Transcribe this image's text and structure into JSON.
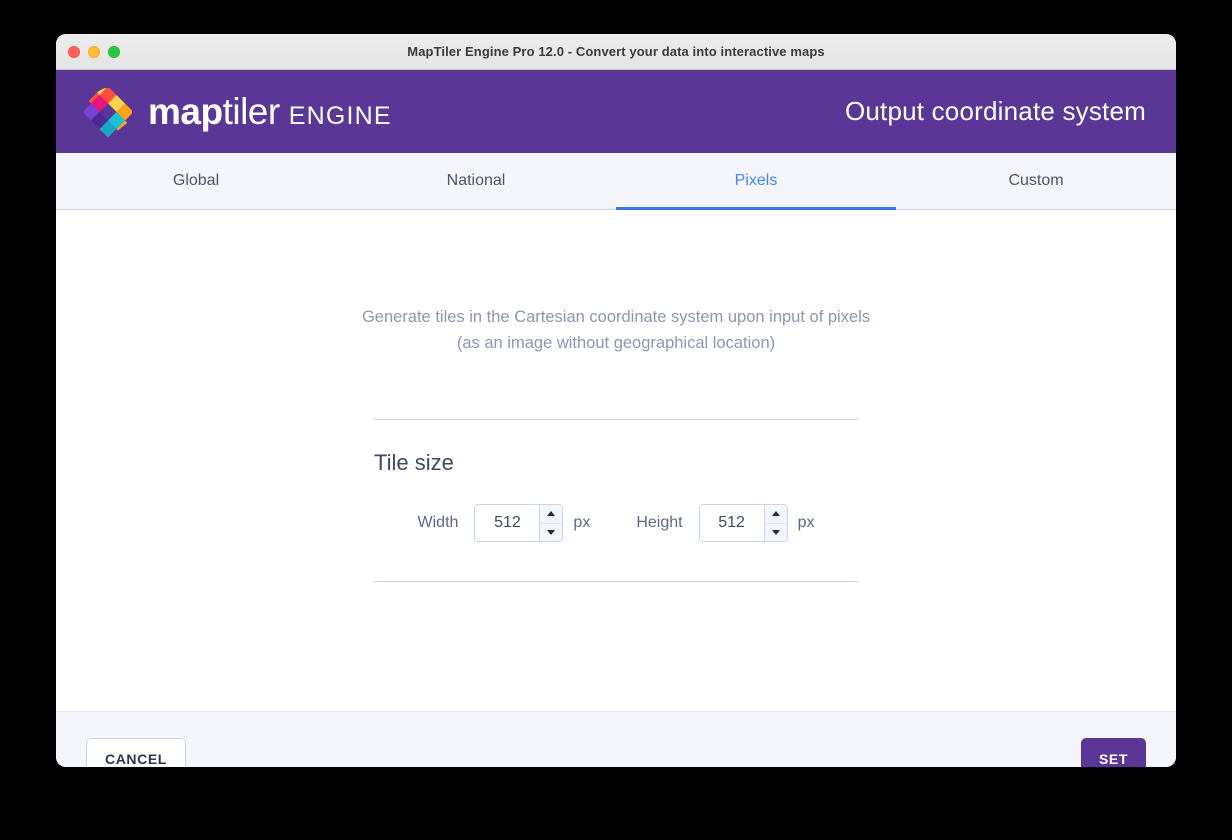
{
  "window": {
    "title": "MapTiler Engine Pro 12.0 - Convert your data into interactive maps",
    "controls": {
      "close": "close-button",
      "minimize": "minimize-button",
      "maximize": "maximize-button"
    }
  },
  "header": {
    "brand_map": "map",
    "brand_tiler": "tiler",
    "brand_engine": "ENGINE",
    "title": "Output coordinate system",
    "background_color": "#5a3696",
    "logo_colors": {
      "top_left": "#ff4d4d",
      "top_right": "#ffb020",
      "top_center": "#ffd24d",
      "mid_left": "#e8157a",
      "mid_right": "#17c2d4",
      "center": "#5a3696",
      "bottom_left": "#7b3fd4",
      "bottom_right": "#1aa8c4",
      "bottom_center": "#4b2a93"
    }
  },
  "tabs": {
    "active_index": 2,
    "active_color": "#4285f4",
    "underline_color": "#3b73e8",
    "items": [
      {
        "label": "Global"
      },
      {
        "label": "National"
      },
      {
        "label": "Pixels"
      },
      {
        "label": "Custom"
      }
    ]
  },
  "main": {
    "description_line_1": "Generate tiles in the Cartesian coordinate system upon input of pixels",
    "description_line_2": "(as an image without geographical location)",
    "section_title": "Tile size",
    "width": {
      "label": "Width",
      "value": "512",
      "unit": "px"
    },
    "height": {
      "label": "Height",
      "value": "512",
      "unit": "px"
    }
  },
  "footer": {
    "cancel_label": "CANCEL",
    "set_label": "SET",
    "set_color": "#5a3696"
  }
}
